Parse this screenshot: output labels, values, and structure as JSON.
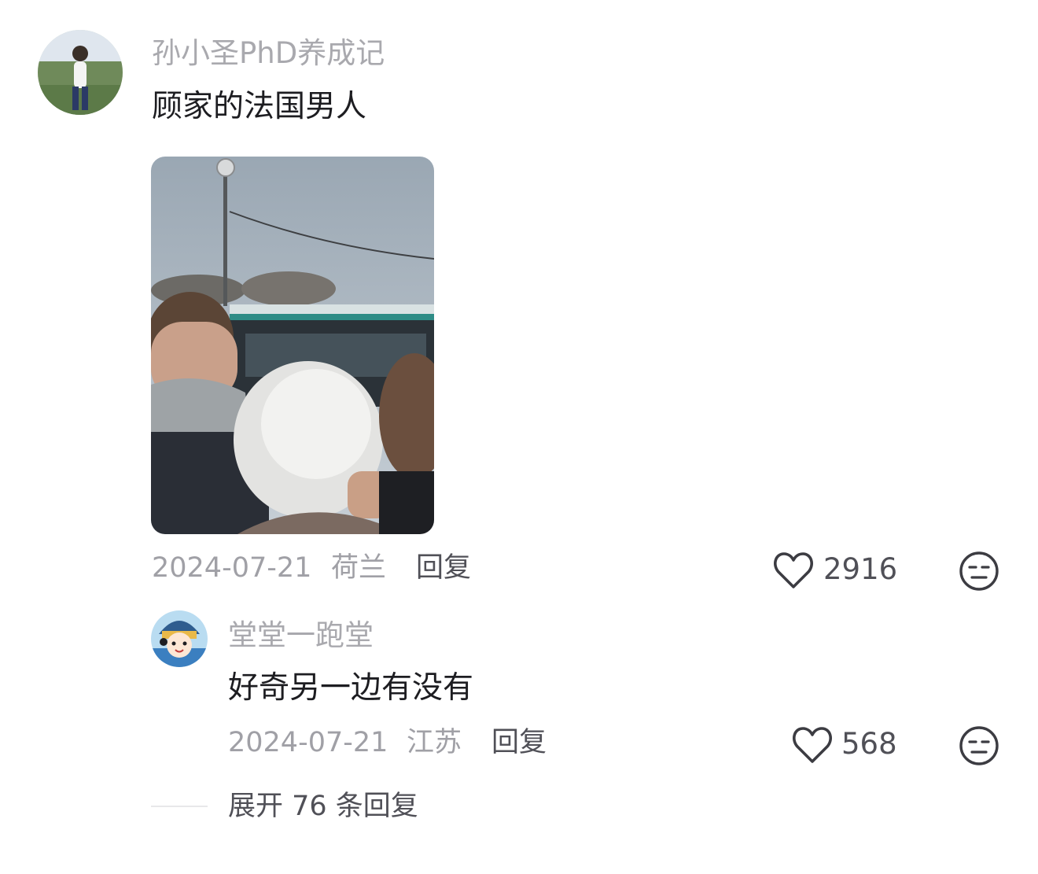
{
  "comment": {
    "username": "孙小圣PhD养成记",
    "text": "顾家的法国男人",
    "date": "2024-07-21",
    "location": "荷兰",
    "reply_label": "回复",
    "likes": "2916"
  },
  "reply": {
    "username": "堂堂一跑堂",
    "text": "好奇另一边有没有",
    "date": "2024-07-21",
    "location": "江苏",
    "reply_label": "回复",
    "likes": "568"
  },
  "expand_replies": "展开 76 条回复",
  "icons": {
    "like": "heart-outline-icon",
    "dislike": "meh-face-icon"
  },
  "colors": {
    "username": "#a9a9ae",
    "text": "#1d1d21",
    "meta": "#a0a0a6",
    "action": "#505057"
  }
}
